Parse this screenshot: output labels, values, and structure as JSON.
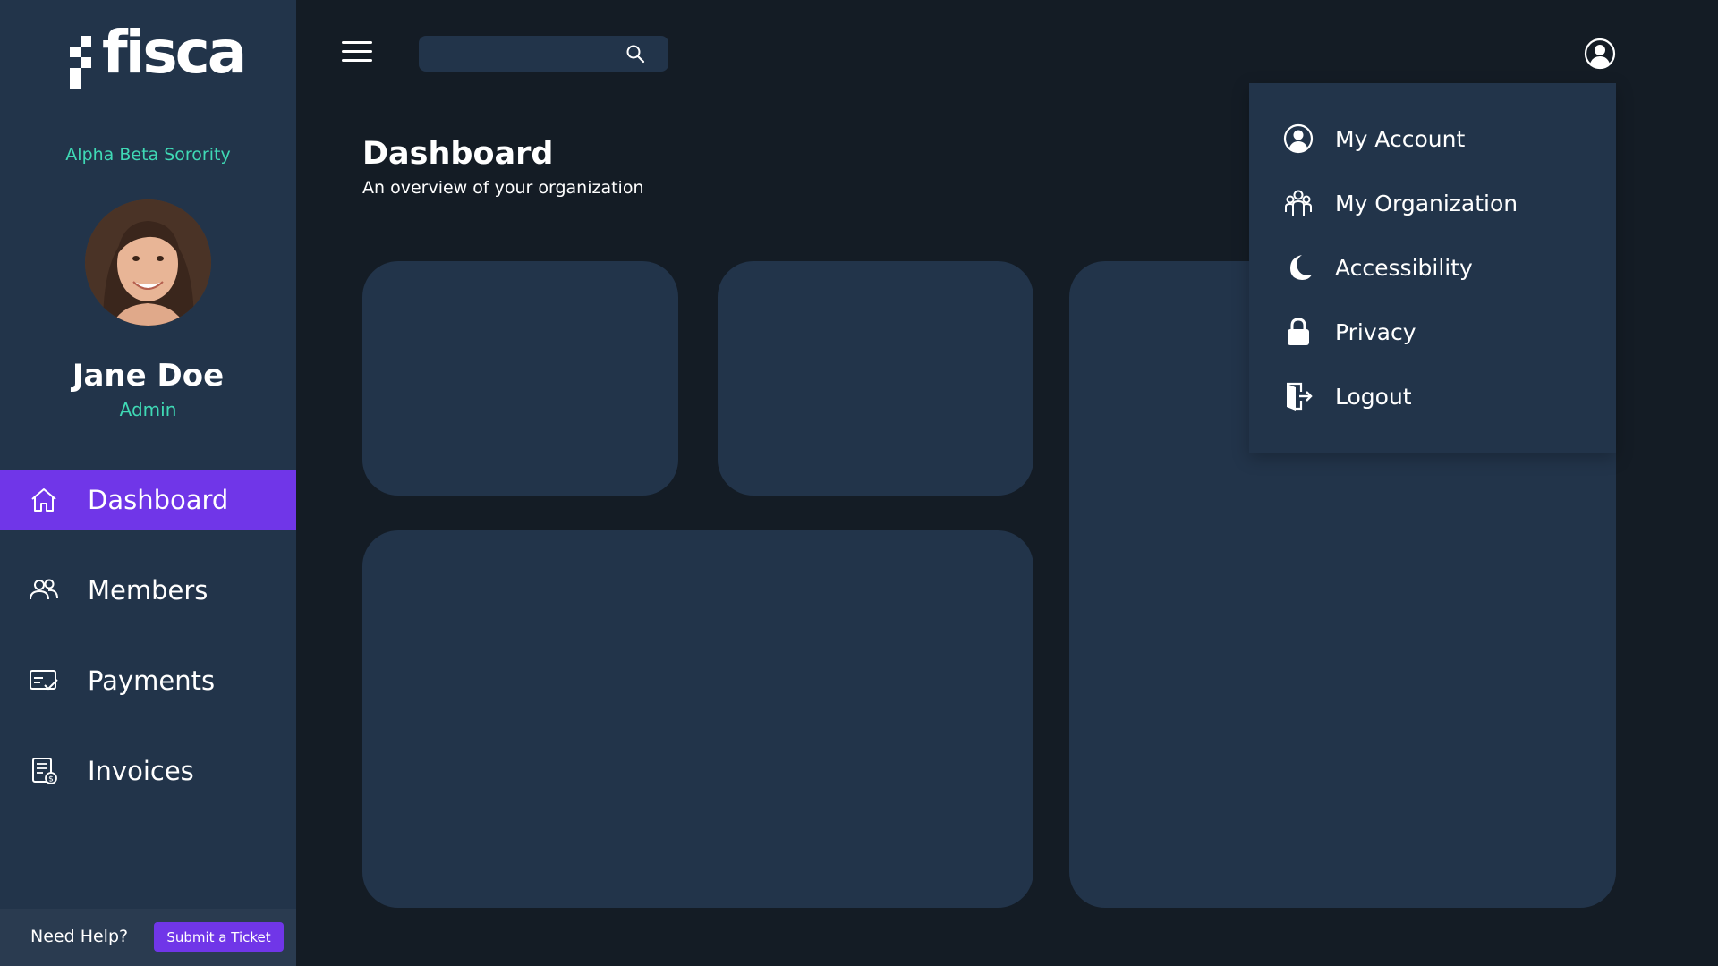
{
  "brand": {
    "logo_text": "fisca"
  },
  "sidebar": {
    "org_name": "Alpha Beta Sorority",
    "user": {
      "name": "Jane Doe",
      "role": "Admin"
    },
    "items": [
      {
        "label": "Dashboard",
        "icon": "home-icon",
        "active": true
      },
      {
        "label": "Members",
        "icon": "members-icon",
        "active": false
      },
      {
        "label": "Payments",
        "icon": "payments-icon",
        "active": false
      },
      {
        "label": "Invoices",
        "icon": "invoices-icon",
        "active": false
      }
    ],
    "help": {
      "text": "Need Help?",
      "button_label": "Submit a Ticket"
    }
  },
  "topbar": {
    "search": {
      "value": "",
      "placeholder": "",
      "icon": "search-icon"
    },
    "menu_icon": "hamburger-icon",
    "profile_icon": "user-circle-icon"
  },
  "main": {
    "title": "Dashboard",
    "subtitle": "An overview of your organization"
  },
  "profile_menu": {
    "items": [
      {
        "label": "My Account",
        "icon": "user-circle-icon"
      },
      {
        "label": "My Organization",
        "icon": "organization-icon"
      },
      {
        "label": "Accessibility",
        "icon": "moon-icon"
      },
      {
        "label": "Privacy",
        "icon": "lock-icon"
      },
      {
        "label": "Logout",
        "icon": "logout-icon"
      }
    ]
  },
  "colors": {
    "background": "#141c25",
    "panel": "#22344a",
    "accent": "#7036e8",
    "highlight": "#3fd9b5"
  }
}
